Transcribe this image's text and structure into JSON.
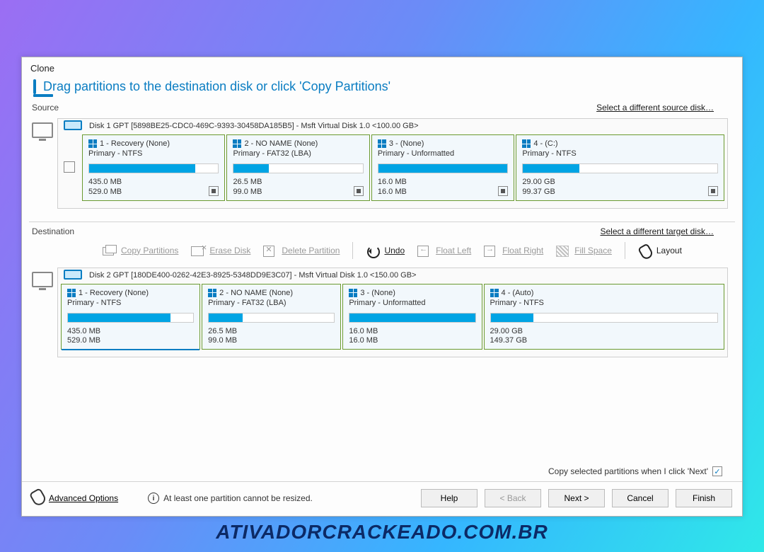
{
  "footer": "ATIVADORCRACKEADO.COM.BR",
  "window_title": "Clone",
  "header_text": "Drag partitions to the destination disk or click 'Copy Partitions'",
  "source": {
    "label": "Source",
    "link": "Select a different source disk…",
    "disk_label": "Disk 1 GPT [5898BE25-CDC0-469C-9393-30458DA185B5] - Msft    Virtual Disk    1.0  <100.00 GB>",
    "parts": [
      {
        "title": "1 - Recovery (None)",
        "sub": "Primary - NTFS",
        "fill_pct": 82,
        "used": "435.0 MB",
        "total": "529.0 MB",
        "stop": true
      },
      {
        "title": "2 - NO NAME (None)",
        "sub": "Primary - FAT32 (LBA)",
        "fill_pct": 27,
        "used": "26.5 MB",
        "total": "99.0 MB",
        "stop": true
      },
      {
        "title": "3 -  (None)",
        "sub": "Primary - Unformatted",
        "fill_pct": 100,
        "used": "16.0 MB",
        "total": "16.0 MB",
        "stop": true
      },
      {
        "title": "4 -  (C:)",
        "sub": "Primary - NTFS",
        "fill_pct": 29,
        "used": "29.00 GB",
        "total": "99.37 GB",
        "stop": true
      }
    ]
  },
  "dest": {
    "label": "Destination",
    "link": "Select a different target disk…",
    "disk_label": "Disk 2 GPT [180DE400-0262-42E3-8925-5348DD9E3C07] - Msft    Virtual Disk    1.0  <150.00 GB>",
    "parts": [
      {
        "title": "1 - Recovery (None)",
        "sub": "Primary - NTFS",
        "fill_pct": 82,
        "used": "435.0 MB",
        "total": "529.0 MB"
      },
      {
        "title": "2 - NO NAME (None)",
        "sub": "Primary - FAT32 (LBA)",
        "fill_pct": 27,
        "used": "26.5 MB",
        "total": "99.0 MB"
      },
      {
        "title": "3 -  (None)",
        "sub": "Primary - Unformatted",
        "fill_pct": 100,
        "used": "16.0 MB",
        "total": "16.0 MB"
      },
      {
        "title": "4 -  (Auto)",
        "sub": "Primary - NTFS",
        "fill_pct": 19,
        "used": "29.00 GB",
        "total": "149.37 GB"
      }
    ]
  },
  "toolbar": {
    "copy": "Copy Partitions",
    "erase": "Erase Disk",
    "del": "Delete Partition",
    "undo": "Undo",
    "fleft": "Float Left",
    "fright": "Float Right",
    "fill": "Fill Space",
    "layout": "Layout"
  },
  "check_row": "Copy selected partitions when I click 'Next'",
  "advanced": "Advanced Options",
  "info": "At least one partition cannot be resized.",
  "buttons": {
    "help": "Help",
    "back": "< Back",
    "next": "Next >",
    "cancel": "Cancel",
    "finish": "Finish"
  }
}
